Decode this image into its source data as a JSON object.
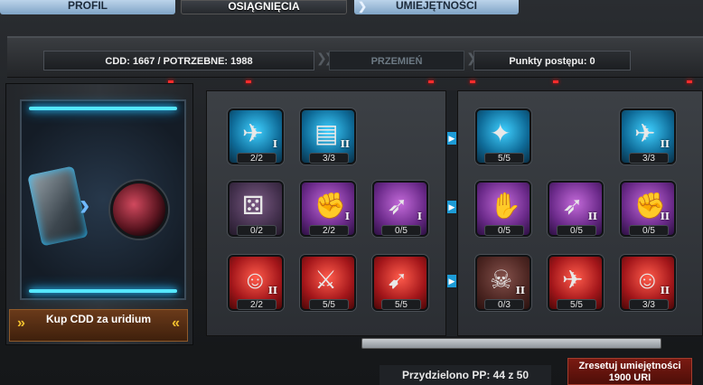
{
  "tabs": [
    {
      "label": "PROFIL",
      "active": false
    },
    {
      "label": "OSIĄGNIĘCIA",
      "active": false
    },
    {
      "label": "UMIEJĘTNOŚCI",
      "active": true
    }
  ],
  "header": {
    "cdd_text": "CDD: 1667 / POTRZEBNE: 1988",
    "transform_label": "PRZEMIEŃ",
    "progress_points_text": "Punkty postępu: 0"
  },
  "left": {
    "buy_cdd_label": "Kup CDD za uridium"
  },
  "skills_left": [
    {
      "count": "2/2",
      "level": "I",
      "color": "blue",
      "icon": "laser-icon"
    },
    {
      "count": "3/3",
      "level": "II",
      "color": "blue",
      "icon": "money-icon"
    },
    {
      "count": "0/2",
      "level": "",
      "color": "purple-dim",
      "icon": "dice-icon"
    },
    {
      "count": "2/2",
      "level": "I",
      "color": "purple",
      "icon": "fist-icon"
    },
    {
      "count": "0/5",
      "level": "I",
      "color": "purple",
      "icon": "ammo-icon"
    },
    {
      "count": "2/2",
      "level": "II",
      "color": "red",
      "icon": "pilot-icon"
    },
    {
      "count": "5/5",
      "level": "",
      "color": "red",
      "icon": "rocket-launcher-icon"
    },
    {
      "count": "5/5",
      "level": "",
      "color": "red",
      "icon": "rocket-icon"
    }
  ],
  "skills_right": [
    {
      "count": "5/5",
      "level": "",
      "color": "blue",
      "icon": "shield-icon"
    },
    {
      "count": "3/3",
      "level": "II",
      "color": "blue",
      "icon": "laser-icon"
    },
    {
      "count": "0/5",
      "level": "",
      "color": "purple",
      "icon": "hand-icon"
    },
    {
      "count": "0/5",
      "level": "II",
      "color": "purple",
      "icon": "ammo-icon"
    },
    {
      "count": "0/5",
      "level": "II",
      "color": "purple",
      "icon": "fist-icon"
    },
    {
      "count": "0/3",
      "level": "II",
      "color": "red-dim",
      "icon": "skull-icon"
    },
    {
      "count": "5/5",
      "level": "",
      "color": "red",
      "icon": "ship-icon"
    },
    {
      "count": "3/3",
      "level": "II",
      "color": "red",
      "icon": "pilot-icon"
    }
  ],
  "footer": {
    "assigned_pp": "Przydzielono PP: 44 z 50",
    "reset_label": "Zresetuj umiejętności",
    "reset_cost": "1900 URI"
  }
}
